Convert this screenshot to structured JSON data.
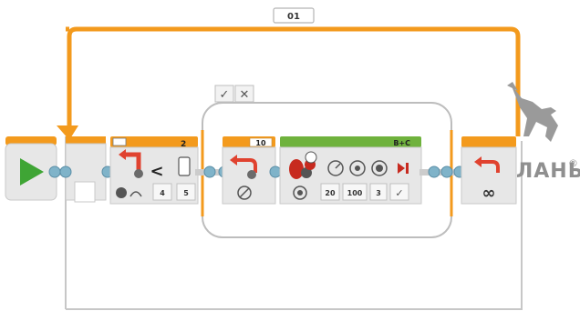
{
  "loop": {
    "name": "01",
    "mode_icon": "infinity-icon"
  },
  "start_block": {
    "icon": "play-icon"
  },
  "wait_block": {
    "port": "2",
    "compare_symbol": "<",
    "icon": "ultrasonic-sensor-icon",
    "mode_icon": "distance-icon",
    "params": [
      "4",
      "5"
    ]
  },
  "switch_block": {
    "true_case": "✓",
    "false_case": "✕"
  },
  "inner_loop_block": {
    "name": "10",
    "icon": "loop-icon",
    "mode_icon": "unlimited-icon"
  },
  "move_block": {
    "ports": "B+C",
    "icon": "steering-icon",
    "param_icons": [
      "steering-icon",
      "power-icon",
      "rotations-icon",
      "brake-icon"
    ],
    "params": [
      "20",
      "100",
      "3",
      "✓"
    ]
  },
  "loop_end_block": {
    "icon": "loop-end-icon"
  },
  "watermark": {
    "text": "ЛАНЬ",
    "mark": "®"
  },
  "colors": {
    "orange": "#f39a1d",
    "green": "#6fb23d",
    "block_gray": "#e7e7e7",
    "wire": "#cccccc"
  }
}
